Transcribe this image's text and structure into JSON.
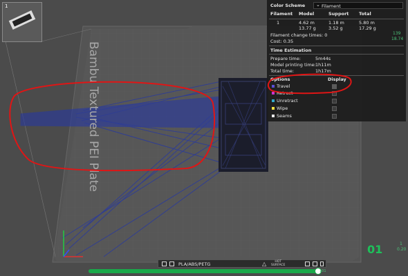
{
  "plate": {
    "label": "Bambu Textured PEI Plate",
    "plate_number": "1"
  },
  "legend": {
    "title": "Color Scheme",
    "scheme_value": "Filament",
    "table_headers": [
      "Filament",
      "Model",
      "Support",
      "Total"
    ],
    "rows": [
      {
        "filament": "1",
        "model": [
          "4.62 m",
          "13.77 g"
        ],
        "support": [
          "1.18 m",
          "3.52 g"
        ],
        "total": [
          "5.80 m",
          "17.29 g"
        ]
      }
    ],
    "filament_change_times": "Filament change times:  0",
    "cost": "Cost:  0.35",
    "time_title": "Time Estimation",
    "times": [
      {
        "label": "Prepare time:",
        "value": "5m44s"
      },
      {
        "label": "Model printing time:",
        "value": "1h11m"
      },
      {
        "label": "Total time:",
        "value": "1h17m"
      }
    ],
    "options_header": "Options",
    "display_header": "Display",
    "options": [
      {
        "label": "Travel",
        "color": "#5a4fd6"
      },
      {
        "label": "Retract",
        "color": "#cc33cc"
      },
      {
        "label": "Unretract",
        "color": "#33aacc"
      },
      {
        "label": "Wipe",
        "color": "#f0e040"
      },
      {
        "label": "Seams",
        "color": "#e8e8e8"
      }
    ]
  },
  "layer_stats": {
    "top_value_1": "139",
    "top_value_2": "18.74",
    "bottom_value_1": "1",
    "bottom_value_2": "0.20",
    "current_layer": "01"
  },
  "bottom_bar": {
    "filament_type": "PLA/ABS/PETG",
    "hot_surface": [
      "HOT",
      "SURFACE"
    ],
    "slider_end": "101"
  },
  "colors": {
    "travel_path": "#2a3a9c",
    "annotation": "#e01515",
    "accent_green": "#1ec05a"
  }
}
